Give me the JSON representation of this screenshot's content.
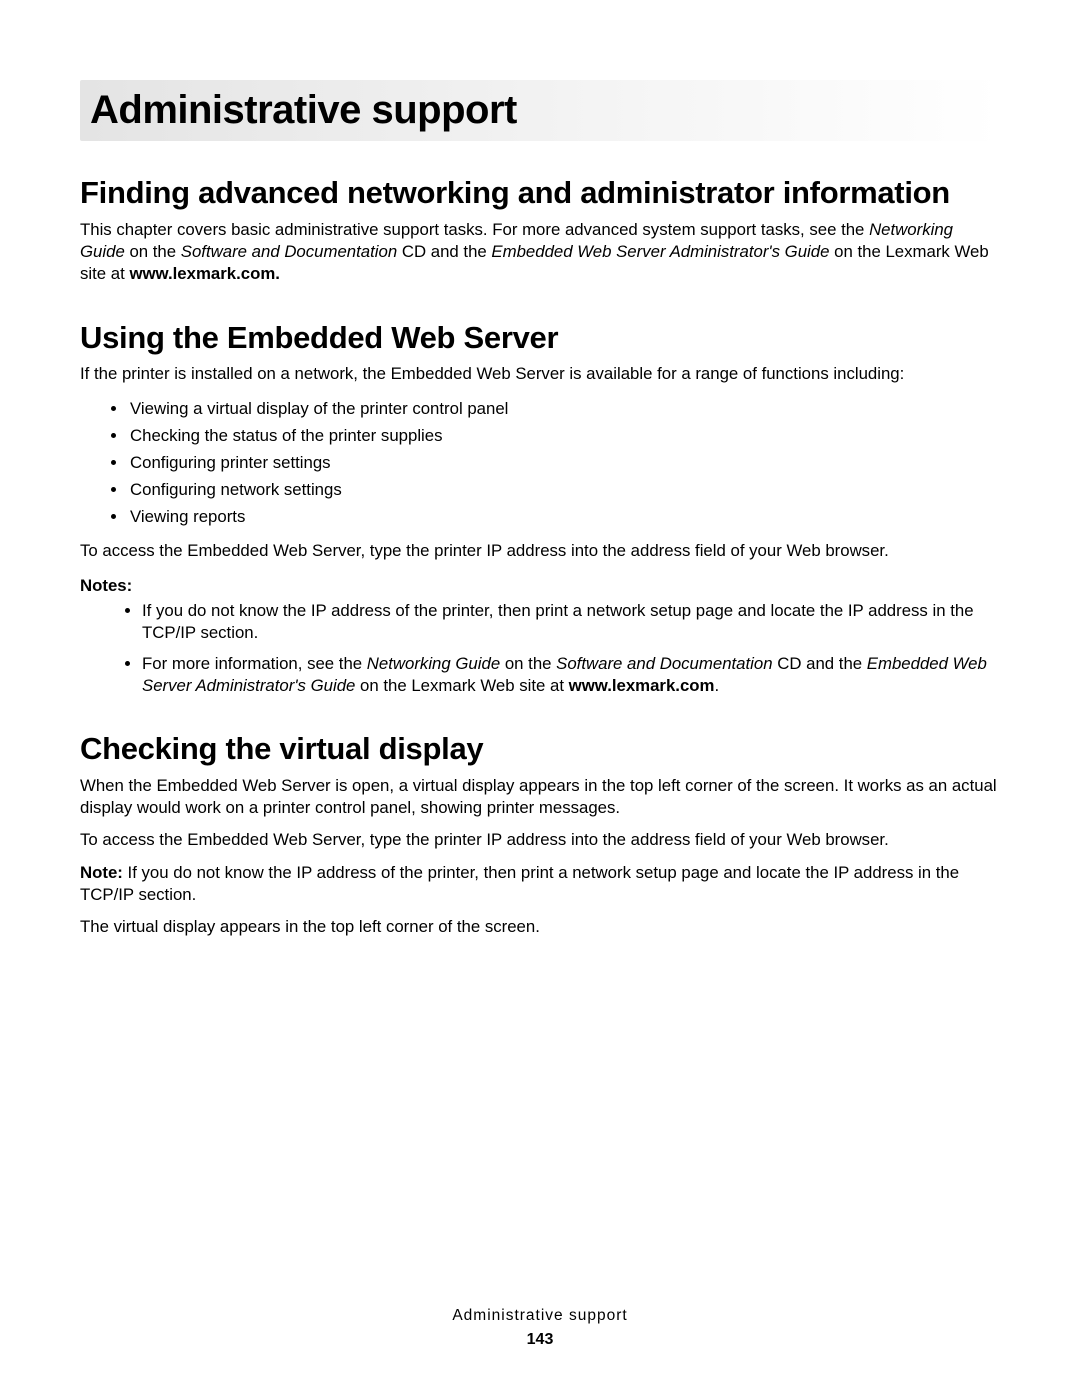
{
  "chapter_title": "Administrative support",
  "section1": {
    "heading": "Finding advanced networking and administrator information",
    "para_pre": "This chapter covers basic administrative support tasks. For more advanced system support tasks, see the ",
    "italic1": "Networking Guide",
    "para_mid1": " on the ",
    "italic2": "Software and Documentation",
    "para_mid2": " CD and the ",
    "italic3": "Embedded Web Server Administrator's Guide",
    "para_mid3": " on the Lexmark Web site at ",
    "bold1": "www.lexmark.com."
  },
  "section2": {
    "heading": "Using the Embedded Web Server",
    "intro": "If the printer is installed on a network, the Embedded Web Server is available for a range of functions including:",
    "bullets": [
      "Viewing a virtual display of the printer control panel",
      "Checking the status of the printer supplies",
      "Configuring printer settings",
      "Configuring network settings",
      "Viewing reports"
    ],
    "after_bullets": "To access the Embedded Web Server, type the printer IP address into the address field of your Web browser.",
    "notes_label": "Notes:",
    "note1": "If you do not know the IP address of the printer, then print a network setup page and locate the IP address in the TCP/IP section.",
    "note2_pre": "For more information, see the ",
    "note2_i1": "Networking Guide",
    "note2_mid1": " on the ",
    "note2_i2": "Software and Documentation",
    "note2_mid2": " CD and the ",
    "note2_i3": "Embedded Web Server Administrator's Guide",
    "note2_mid3": " on the Lexmark Web site at ",
    "note2_bold": "www.lexmark.com",
    "note2_end": "."
  },
  "section3": {
    "heading": "Checking the virtual display",
    "p1": "When the Embedded Web Server is open, a virtual display appears in the top left corner of the screen. It works as an actual display would work on a printer control panel, showing printer messages.",
    "p2": "To access the Embedded Web Server, type the printer IP address into the address field of your Web browser.",
    "p3_bold": "Note:",
    "p3_rest": " If you do not know the IP address of the printer, then print a network setup page and locate the IP address in the TCP/IP section.",
    "p4": "The virtual display appears in the top left corner of the screen."
  },
  "footer": {
    "title": "Administrative support",
    "page": "143"
  }
}
